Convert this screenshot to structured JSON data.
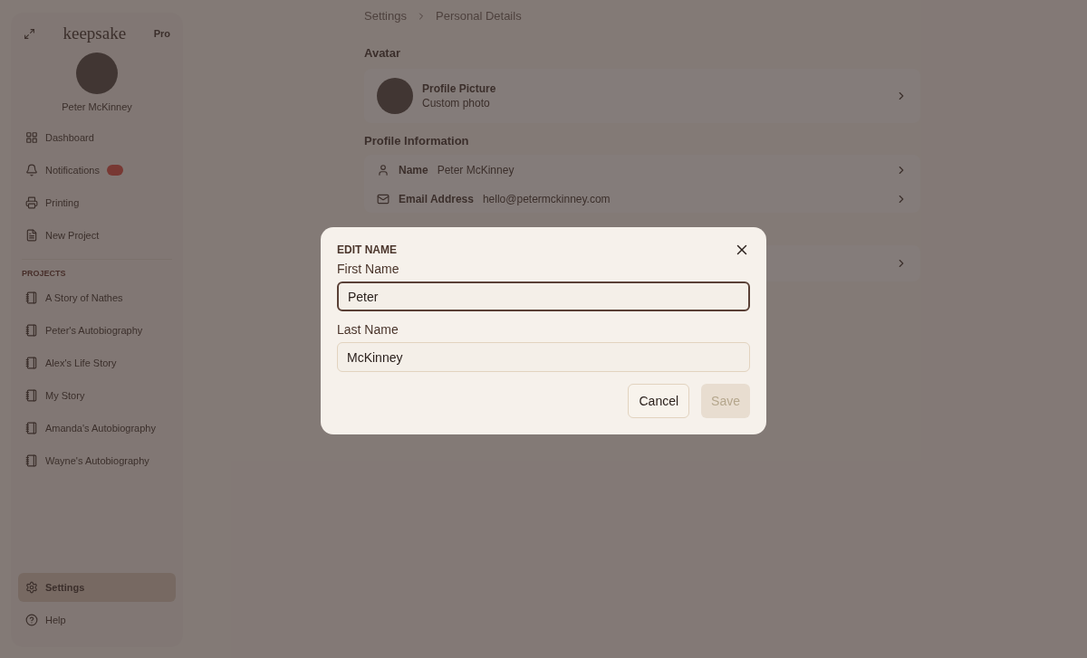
{
  "sidebar": {
    "logo": "keepsake",
    "plan_badge": "Pro",
    "user_name": "Peter McKinney",
    "nav": [
      {
        "label": "Dashboard",
        "kind": "home",
        "badge_on": false
      },
      {
        "label": "Notifications",
        "kind": "bell",
        "badge_on": true
      },
      {
        "label": "Printing",
        "kind": "printer",
        "badge_on": false
      },
      {
        "label": "New Project",
        "kind": "doc",
        "badge_on": false
      }
    ],
    "projects_heading": "PROJECTS",
    "projects": [
      "A Story of Nathes",
      "Peter's Autobiography",
      "Alex's Life Story",
      "My Story",
      "Amanda's Autobiography",
      "Wayne's Autobiography"
    ],
    "footer": [
      {
        "label": "Settings",
        "kind": "gear",
        "selected": true
      },
      {
        "label": "Help",
        "kind": "help",
        "selected": false
      }
    ]
  },
  "breadcrumb": [
    "Settings",
    "Personal Details"
  ],
  "avatar_section": {
    "heading": "Avatar",
    "title": "Profile Picture",
    "subtitle": "Custom photo"
  },
  "profile_section": {
    "heading": "Profile Information",
    "rows": [
      {
        "kind": "person",
        "label": "Name",
        "value": "Peter McKinney"
      },
      {
        "kind": "mail",
        "label": "Email Address",
        "value": "hello@petermckinney.com"
      }
    ]
  },
  "dialog": {
    "title": "EDIT NAME",
    "fields": [
      {
        "label": "First Name",
        "value": "Peter",
        "focused": true
      },
      {
        "label": "Last Name",
        "value": "McKinney",
        "focused": false
      }
    ],
    "cancel": "Cancel",
    "save": "Save",
    "save_disabled": true
  }
}
